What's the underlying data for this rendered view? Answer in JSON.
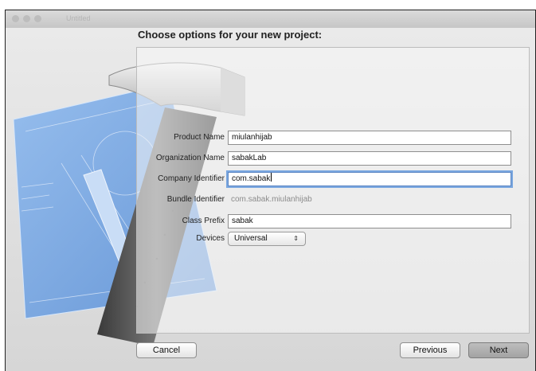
{
  "window": {
    "title": "Untitled"
  },
  "sheet": {
    "title": "Choose options for your new project:"
  },
  "form": {
    "product_name": {
      "label": "Product Name",
      "value": "miulanhijab"
    },
    "organization_name": {
      "label": "Organization Name",
      "value": "sabakLab"
    },
    "company_identifier": {
      "label": "Company Identifier",
      "value": "com.sabak"
    },
    "bundle_identifier": {
      "label": "Bundle Identifier",
      "value": "com.sabak.miulanhijab"
    },
    "class_prefix": {
      "label": "Class Prefix",
      "value": "sabak"
    },
    "devices": {
      "label": "Devices",
      "selected": "Universal",
      "arrows": "⇕"
    }
  },
  "footer": {
    "cancel_label": "Cancel",
    "previous_label": "Previous",
    "next_label": "Next"
  },
  "colors": {
    "blueprint": "#6fa2e0",
    "focus_ring": "#7aa7e0"
  },
  "icons": {
    "illustration": "xcode-hammer-blueprint-icon",
    "select_arrows": "up-down-arrows-icon"
  }
}
